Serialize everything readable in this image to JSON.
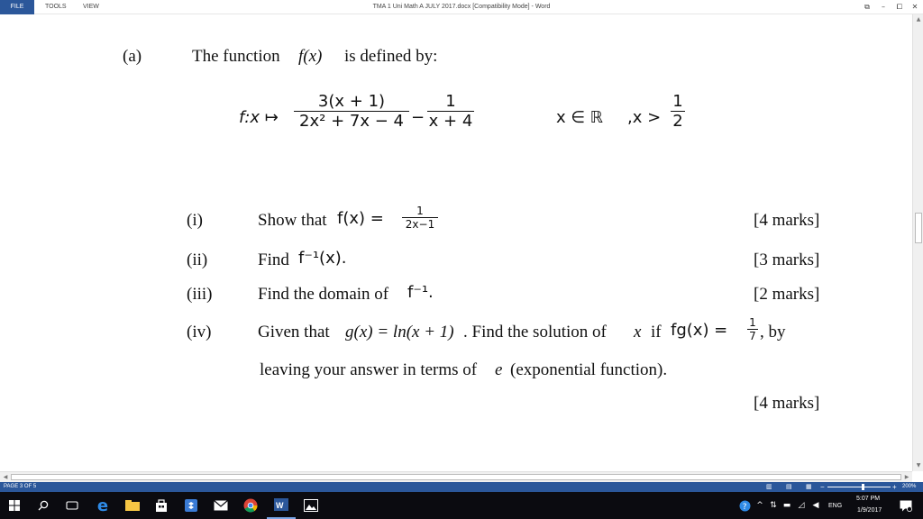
{
  "ribbon": {
    "file": "FILE",
    "tools": "TOOLS",
    "view": "VIEW",
    "title": "TMA 1 Uni Math A JULY 2017.docx [Compatibility Mode] - Word",
    "controls": [
      "⧉",
      "–",
      "⧠",
      "✕"
    ]
  },
  "question": {
    "part": "(a)",
    "intro_text": "The function",
    "intro_fx": "f(x)",
    "intro_suffix": "is defined by:",
    "def_lhs": "f:x ↦",
    "frac1_num": "3(x + 1)",
    "frac1_den": "2x² + 7x − 4",
    "minus": "−",
    "frac2_num": "1",
    "frac2_den": "x + 4",
    "domain": "x ∈ ℝ",
    "condition_lhs": ",x >",
    "cond_num": "1",
    "cond_den": "2",
    "items": [
      {
        "label": "(i)",
        "text": "Show that",
        "math": "f(x) =",
        "frac_num": "1",
        "frac_den": "2x−1",
        "marks": "[4 marks]"
      },
      {
        "label": "(ii)",
        "text": "Find",
        "math": "f⁻¹(x).",
        "marks": "[3 marks]"
      },
      {
        "label": "(iii)",
        "text": "Find the domain of",
        "math": "f⁻¹.",
        "marks": "[2 marks]"
      },
      {
        "label": "(iv)",
        "text": "Given that",
        "math_g": "g(x) = ln(x + 1)",
        "text2": ". Find the solution of",
        "x": "x",
        "if": "if",
        "fg": "fg(x) =",
        "frac_num": "1",
        "frac_den": "7",
        "by": ", by",
        "line2_a": "leaving your answer in terms of",
        "line2_e": "e",
        "line2_b": "(exponential function).",
        "marks": "[4 marks]"
      }
    ]
  },
  "statusbar": {
    "page": "PAGE 3 OF 5",
    "zoom_minus": "−",
    "zoom_plus": "+",
    "zoom": "200%"
  },
  "taskbar": {
    "time": "5:07 PM",
    "date": "1/9/2017",
    "lang": "ENG"
  },
  "colors": {
    "word_blue": "#2b579a",
    "taskbar": "#0b0b10"
  }
}
